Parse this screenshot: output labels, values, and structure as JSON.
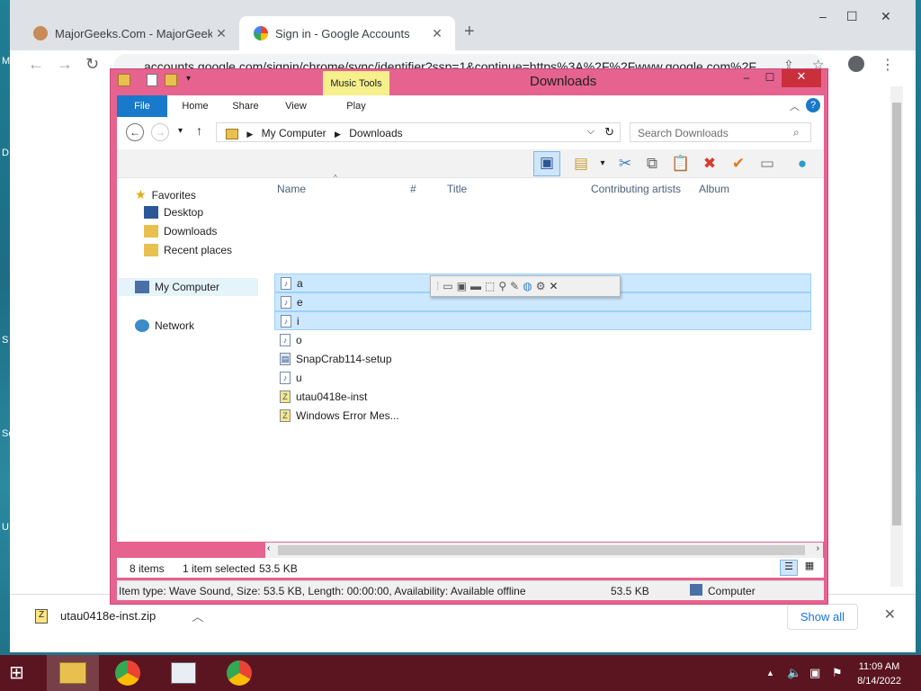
{
  "desktop": {
    "letters": [
      "M",
      "D",
      "S",
      "Sc",
      "U"
    ]
  },
  "chrome": {
    "tabs": [
      {
        "title": "MajorGeeks.Com - MajorGeeks",
        "active": false
      },
      {
        "title": "Sign in - Google Accounts",
        "active": true
      }
    ],
    "new_tab": "+",
    "window_controls": {
      "minimize": "–",
      "maximize": "☐",
      "close": "✕"
    },
    "url": "accounts.google.com/signin/chrome/sync/identifier?ssp=1&continue=https%3A%2F%2Fwww.google.com%2F",
    "download": {
      "filename": "utau0418e-inst.zip",
      "show_all": "Show all"
    }
  },
  "explorer": {
    "title": "Downloads",
    "contextual_tab": "Music Tools",
    "ribbon_tabs": [
      "File",
      "Home",
      "Share",
      "View",
      "Play"
    ],
    "breadcrumb": [
      "My Computer",
      "Downloads"
    ],
    "search_placeholder": "Search Downloads",
    "nav": {
      "favorites": "Favorites",
      "desktop": "Desktop",
      "downloads": "Downloads",
      "recent": "Recent places",
      "computer": "My Computer",
      "network": "Network"
    },
    "columns": [
      "Name",
      "#",
      "Title",
      "Contributing artists",
      "Album"
    ],
    "files": [
      {
        "name": "a",
        "selected": true
      },
      {
        "name": "e",
        "selected": true
      },
      {
        "name": "i",
        "selected": true
      },
      {
        "name": "o",
        "selected": false
      },
      {
        "name": "SnapCrab114-setup",
        "selected": false
      },
      {
        "name": "u",
        "selected": false
      },
      {
        "name": "utau0418e-inst",
        "selected": false
      },
      {
        "name": "Windows Error Mes...",
        "selected": false
      }
    ],
    "status": {
      "items": "8 items",
      "selected": "1 item selected",
      "size": "53.5 KB"
    },
    "details": {
      "info": "Item type: Wave Sound, Size: 53.5 KB, Length: 00:00:00, Availability: Available offline",
      "size": "53.5 KB",
      "location": "Computer"
    }
  },
  "taskbar": {
    "time": "11:09 AM",
    "date": "8/14/2022"
  },
  "colors": {
    "explorer_frame": "#e6628f",
    "taskbar": "#5a1520",
    "selection": "#cce8ff",
    "file_tab": "#1979ca",
    "music_tools": "#f5ef8c"
  }
}
